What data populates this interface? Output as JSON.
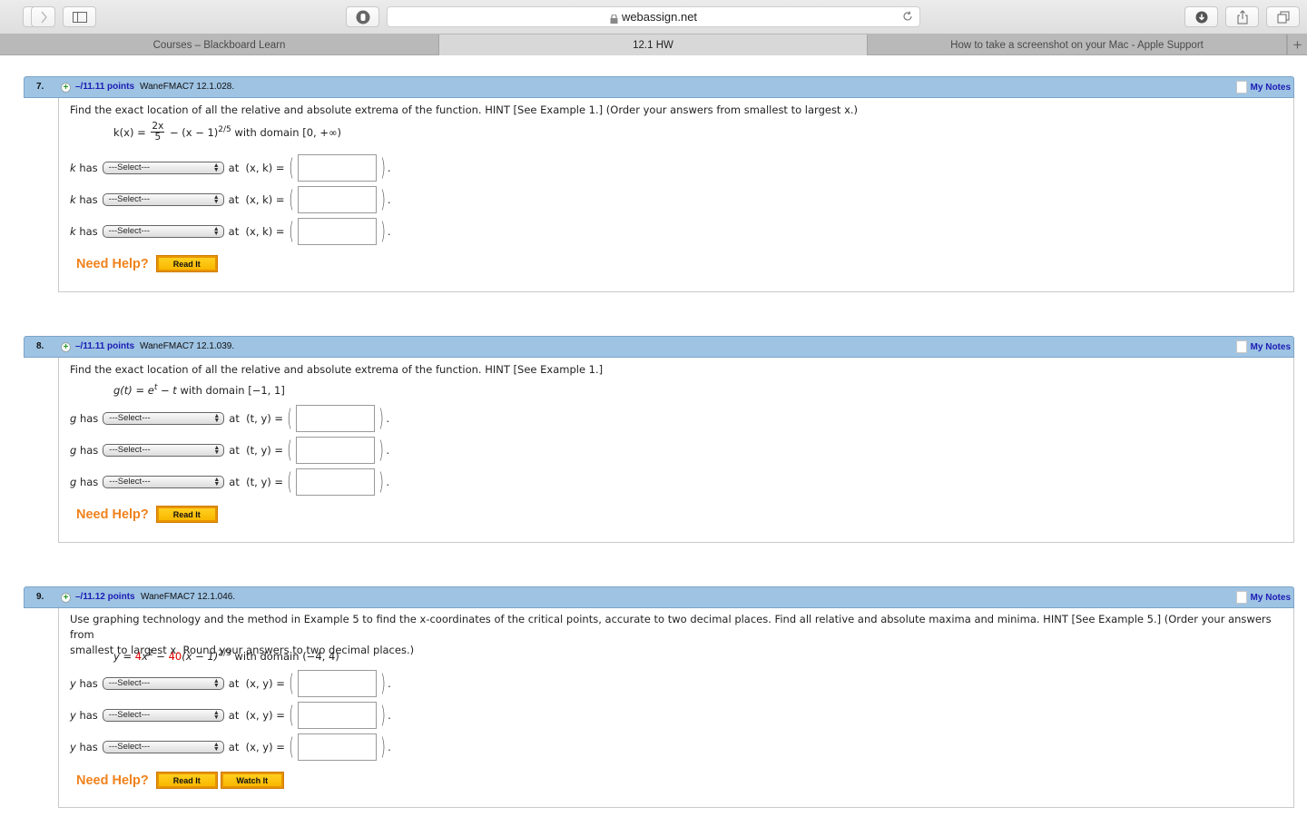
{
  "browser": {
    "address": "webassign.net",
    "tabs": [
      {
        "label": "Courses – Blackboard Learn",
        "active": false
      },
      {
        "label": "12.1 HW",
        "active": true
      },
      {
        "label": "How to take a screenshot on your Mac - Apple Support",
        "active": false
      }
    ],
    "new_tab_label": "+"
  },
  "questions": [
    {
      "number": "7.",
      "points": "–/11.11 points",
      "id": "WaneFMAC7 12.1.028.",
      "my_notes": "My Notes",
      "text": "Find the exact location of all the relative and absolute extrema of the function. HINT [See Example 1.] (Order your answers from smallest to largest x.)",
      "formula": {
        "lhs": "k(x) = ",
        "frac_num": "2x",
        "frac_den": "5",
        "rest": " − (x − 1)",
        "exp": "2/5",
        "domain": " with domain [0, +∞)"
      },
      "rows": [
        {
          "var": "k",
          "has": "has",
          "select": "---Select---",
          "at": "at",
          "pair": "(x, k) ="
        },
        {
          "var": "k",
          "has": "has",
          "select": "---Select---",
          "at": "at",
          "pair": "(x, k) ="
        },
        {
          "var": "k",
          "has": "has",
          "select": "---Select---",
          "at": "at",
          "pair": "(x, k) ="
        }
      ],
      "need_help": "Need Help?",
      "help_buttons": [
        "Read It"
      ]
    },
    {
      "number": "8.",
      "points": "–/11.11 points",
      "id": "WaneFMAC7 12.1.039.",
      "my_notes": "My Notes",
      "text": "Find the exact location of all the relative and absolute extrema of the function. HINT [See Example 1.]",
      "formula": {
        "lhs": "g(t) = e",
        "exp": "t",
        "rest": " − t",
        "domain": " with domain [−1, 1]"
      },
      "rows": [
        {
          "var": "g",
          "has": "has",
          "select": "---Select---",
          "at": "at",
          "pair": "(t, y) ="
        },
        {
          "var": "g",
          "has": "has",
          "select": "---Select---",
          "at": "at",
          "pair": "(t, y) ="
        },
        {
          "var": "g",
          "has": "has",
          "select": "---Select---",
          "at": "at",
          "pair": "(t, y) ="
        }
      ],
      "need_help": "Need Help?",
      "help_buttons": [
        "Read It"
      ]
    },
    {
      "number": "9.",
      "points": "–/11.12 points",
      "id": "WaneFMAC7 12.1.046.",
      "my_notes": "My Notes",
      "text_line1": "Use graphing technology and the method in Example 5 to find the x-coordinates of the critical points, accurate to two decimal places. Find all relative and absolute maxima and minima. HINT [See Example 5.] (Order your answers from",
      "text_line2": "smallest to largest x. Round your answers to two decimal places.)",
      "formula": {
        "lhs": "y = ",
        "coef1": "4",
        "x2": "x",
        "exp1": "2",
        "minus": " − ",
        "coef2": "40",
        "rest": "(x − 1)",
        "exp2": "2/3",
        "domain": " with domain (−4, 4)"
      },
      "rows": [
        {
          "var": "y",
          "has": "has",
          "select": "---Select---",
          "at": "at",
          "pair": "(x, y) ="
        },
        {
          "var": "y",
          "has": "has",
          "select": "---Select---",
          "at": "at",
          "pair": "(x, y) ="
        },
        {
          "var": "y",
          "has": "has",
          "select": "---Select---",
          "at": "at",
          "pair": "(x, y) ="
        }
      ],
      "need_help": "Need Help?",
      "help_buttons": [
        "Read It",
        "Watch It"
      ]
    }
  ],
  "colors": {
    "header_bg": "#9ec3e3",
    "points_link": "#1c1cb4",
    "need_help": "#f0821c",
    "help_button": "#ffc20e",
    "red_coef": "#e00000"
  }
}
